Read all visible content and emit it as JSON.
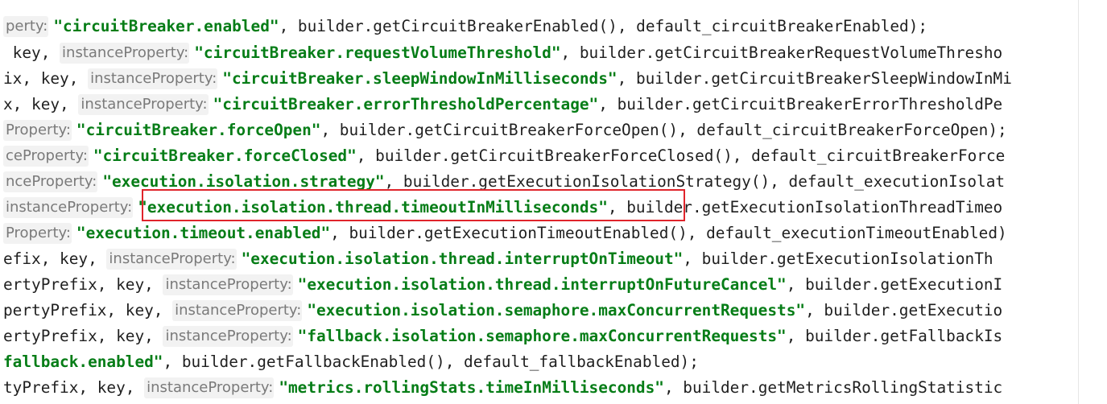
{
  "editor": {
    "lines": [
      {
        "prefix": "",
        "hint": "perty:",
        "value": "\"circuitBreaker.enabled\"",
        "rest": ", builder.getCircuitBreakerEnabled(), default_circuitBreakerEnabled);"
      },
      {
        "prefix": " key, ",
        "hint": "instanceProperty:",
        "value": "\"circuitBreaker.requestVolumeThreshold\"",
        "rest": ", builder.getCircuitBreakerRequestVolumeThresho"
      },
      {
        "prefix": "ix, key, ",
        "hint": "instanceProperty:",
        "value": "\"circuitBreaker.sleepWindowInMilliseconds\"",
        "rest": ", builder.getCircuitBreakerSleepWindowInMi"
      },
      {
        "prefix": "x, key, ",
        "hint": "instanceProperty:",
        "value": "\"circuitBreaker.errorThresholdPercentage\"",
        "rest": ", builder.getCircuitBreakerErrorThresholdPe"
      },
      {
        "prefix": "",
        "hint": "Property:",
        "value": "\"circuitBreaker.forceOpen\"",
        "rest": ", builder.getCircuitBreakerForceOpen(), default_circuitBreakerForceOpen);"
      },
      {
        "prefix": "",
        "hint": "ceProperty:",
        "value": "\"circuitBreaker.forceClosed\"",
        "rest": ", builder.getCircuitBreakerForceClosed(), default_circuitBreakerForce"
      },
      {
        "prefix": "",
        "hint": "nceProperty:",
        "value": "\"execution.isolation.strategy\"",
        "rest": ", builder.getExecutionIsolationStrategy(), default_executionIsolat"
      },
      {
        "prefix": "",
        "hint": "instanceProperty:",
        "value": "\"execution.isolation.thread.timeoutInMilliseconds\"",
        "rest": ", builder.getExecutionIsolationThreadTimeo"
      },
      {
        "prefix": "",
        "hint": "Property:",
        "value": "\"execution.timeout.enabled\"",
        "rest": ", builder.getExecutionTimeoutEnabled(), default_executionTimeoutEnabled)"
      },
      {
        "prefix": "efix, key, ",
        "hint": "instanceProperty:",
        "value": "\"execution.isolation.thread.interruptOnTimeout\"",
        "rest": ", builder.getExecutionIsolationTh"
      },
      {
        "prefix": "ertyPrefix, key, ",
        "hint": "instanceProperty:",
        "value": "\"execution.isolation.thread.interruptOnFutureCancel\"",
        "rest": ", builder.getExecutionI"
      },
      {
        "prefix": "pertyPrefix, key, ",
        "hint": "instanceProperty:",
        "value": "\"execution.isolation.semaphore.maxConcurrentRequests\"",
        "rest": ", builder.getExecutio"
      },
      {
        "prefix": "ertyPrefix, key, ",
        "hint": "instanceProperty:",
        "value": "\"fallback.isolation.semaphore.maxConcurrentRequests\"",
        "rest": ", builder.getFallbackIs"
      },
      {
        "prefix": "",
        "hint": "",
        "value": "fallback.enabled\"",
        "rest": ", builder.getFallbackEnabled(), default_fallbackEnabled);"
      },
      {
        "prefix": "tyPrefix, key, ",
        "hint": "instanceProperty:",
        "value": "\"metrics.rollingStats.timeInMilliseconds\"",
        "rest": ", builder.getMetricsRollingStatistic"
      }
    ]
  },
  "colors": {
    "string_literal": "#067d17",
    "inlay_hint_text": "#7a7a7a",
    "inlay_hint_bg": "#f2f2f2",
    "highlight_border": "#e0242b",
    "background": "#ffffff"
  }
}
